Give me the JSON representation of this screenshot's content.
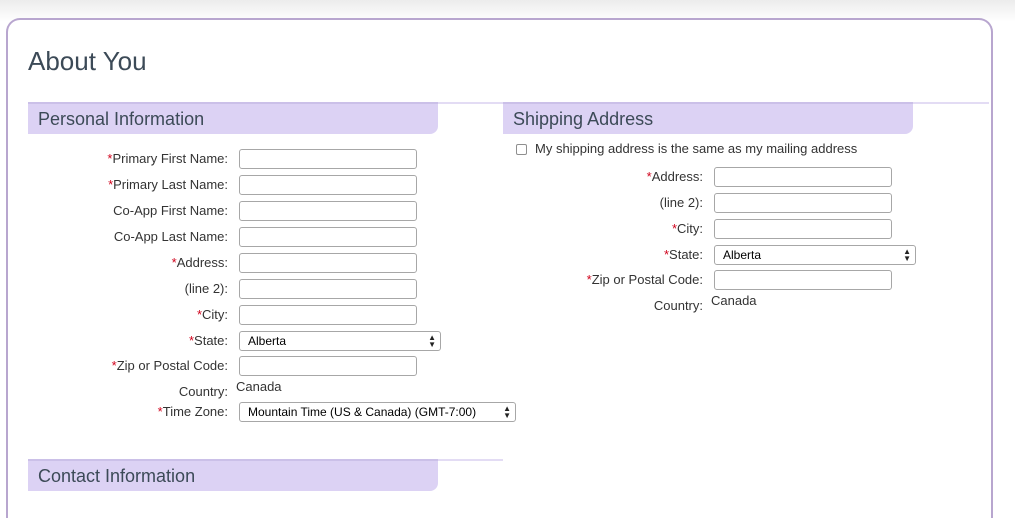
{
  "page": {
    "title": "About You"
  },
  "personal": {
    "title": "Personal Information",
    "fields": [
      {
        "label": "Primary First Name:",
        "required": true,
        "value": ""
      },
      {
        "label": "Primary Last Name:",
        "required": true,
        "value": ""
      },
      {
        "label": "Co-App First Name:",
        "required": false,
        "value": ""
      },
      {
        "label": "Co-App Last Name:",
        "required": false,
        "value": ""
      },
      {
        "label": "Address:",
        "required": true,
        "value": ""
      },
      {
        "label": "(line 2):",
        "required": false,
        "value": ""
      },
      {
        "label": "City:",
        "required": true,
        "value": ""
      }
    ],
    "state": {
      "label": "State:",
      "value": "Alberta"
    },
    "zip": {
      "label": "Zip or Postal Code:",
      "value": ""
    },
    "country": {
      "label": "Country:",
      "value": "Canada"
    },
    "timezone": {
      "label": "Time Zone:",
      "value": "Mountain Time (US & Canada) (GMT-7:00)"
    }
  },
  "shipping": {
    "title": "Shipping Address",
    "same_as_mailing": {
      "label": "My shipping address is the same as my mailing address",
      "checked": false
    },
    "fields": [
      {
        "label": "Address:",
        "required": true,
        "value": ""
      },
      {
        "label": "(line 2):",
        "required": false,
        "value": ""
      },
      {
        "label": "City:",
        "required": true,
        "value": ""
      }
    ],
    "state": {
      "label": "State:",
      "value": "Alberta"
    },
    "zip": {
      "label": "Zip or Postal Code:",
      "value": ""
    },
    "country": {
      "label": "Country:",
      "value": "Canada"
    }
  },
  "contact": {
    "title": "Contact Information"
  },
  "required_marker": "*",
  "colors": {
    "section_bg": "#dcd2f4",
    "card_border": "#b8a6cf",
    "required": "#d0021b",
    "title": "#3c4a57"
  },
  "icons": {
    "select_arrows": "select-arrows-icon"
  }
}
